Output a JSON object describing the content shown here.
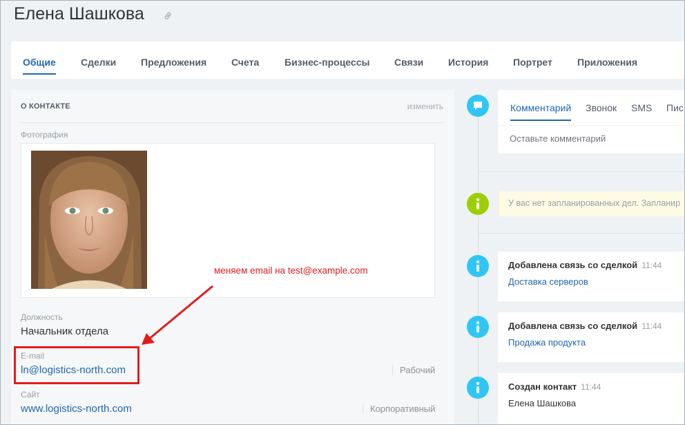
{
  "header": {
    "title": "Елена Шашкова",
    "link_icon": "link-icon"
  },
  "tabs": [
    {
      "label": "Общие",
      "active": true
    },
    {
      "label": "Сделки"
    },
    {
      "label": "Предложения"
    },
    {
      "label": "Счета"
    },
    {
      "label": "Бизнес-процессы"
    },
    {
      "label": "Связи"
    },
    {
      "label": "История"
    },
    {
      "label": "Портрет"
    },
    {
      "label": "Приложения"
    }
  ],
  "contact": {
    "section_title": "О КОНТАКТЕ",
    "edit_label": "изменить",
    "photo_label": "Фотография",
    "position_label": "Должность",
    "position_value": "Начальник отдела",
    "email_label": "E-mail",
    "email_value": "ln@logistics-north.com",
    "email_type": "Рабочий",
    "site_label": "Сайт",
    "site_value": "www.logistics-north.com",
    "site_type": "Корпоративный"
  },
  "annotation": {
    "text": "меняем email на test@example.com",
    "color": "#e01f1f"
  },
  "composer": {
    "tabs": [
      "Комментарий",
      "Звонок",
      "SMS",
      "Пис"
    ],
    "placeholder": "Оставьте комментарий"
  },
  "timeline": {
    "plan_text": "У вас нет запланированных дел. Запланир",
    "events": [
      {
        "title": "Добавлена связь со сделкой",
        "time": "11:44",
        "link": "Доставка серверов"
      },
      {
        "title": "Добавлена связь со сделкой",
        "time": "11:44",
        "link": "Продажа продукта"
      },
      {
        "title": "Создан контакт",
        "time": "11:44",
        "text": "Елена Шашкова"
      }
    ]
  },
  "colors": {
    "accent": "#2067b0",
    "timeline_blue": "#2fc6f6",
    "timeline_green": "#9dcf00",
    "annotation_red": "#e31b1b"
  }
}
